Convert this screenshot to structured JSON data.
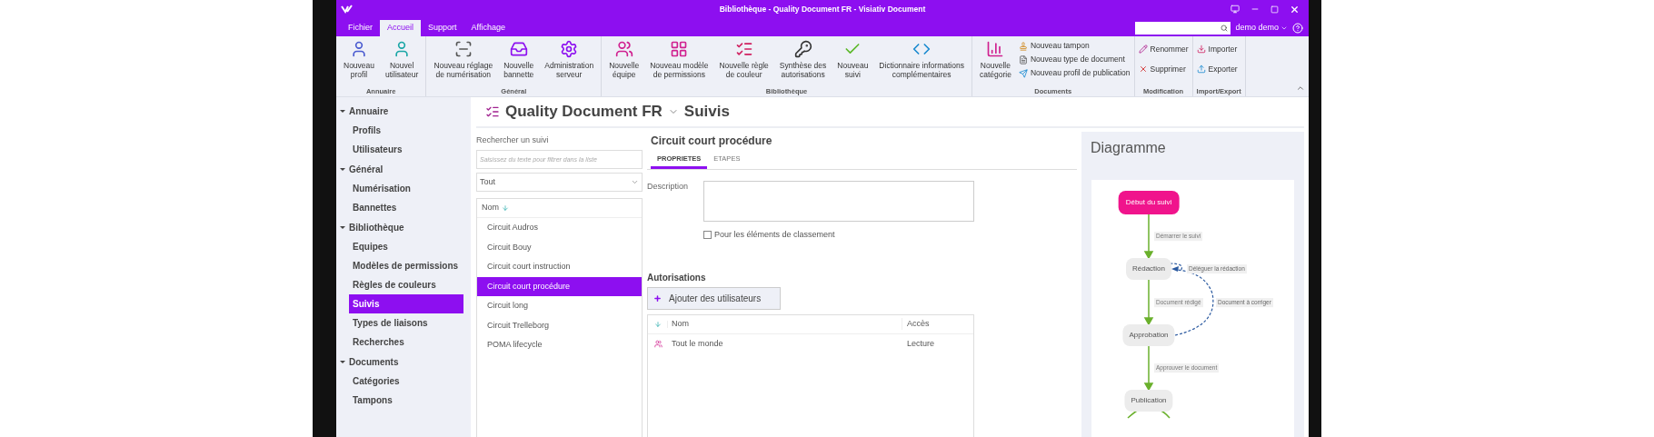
{
  "window": {
    "title": "Bibliothèque - Quality Document FR - Visiativ Document"
  },
  "menu_tabs": [
    {
      "label": "Fichier",
      "selected": false
    },
    {
      "label": "Accueil",
      "selected": true
    },
    {
      "label": "Support",
      "selected": false
    },
    {
      "label": "Affichage",
      "selected": false
    }
  ],
  "user": {
    "name": "demo demo"
  },
  "ribbon": [
    {
      "group": "Annuaire",
      "items": [
        {
          "label": "Nouveau\nprofil"
        },
        {
          "label": "Nouvel\nutilisateur"
        }
      ]
    },
    {
      "group": "Général",
      "items": [
        {
          "label": "Nouveau réglage\nde numérisation"
        },
        {
          "label": "Nouvelle\nbannette"
        },
        {
          "label": "Administration\nserveur"
        }
      ]
    },
    {
      "group": "Bibliothèque",
      "items": [
        {
          "label": "Nouvelle\néquipe"
        },
        {
          "label": "Nouveau modèle\nde permissions"
        },
        {
          "label": "Nouvelle règle\nde couleur"
        },
        {
          "label": "Synthèse des\nautorisations"
        },
        {
          "label": "Nouveau\nsuivi"
        },
        {
          "label": "Dictionnaire informations\ncomplémentaires"
        }
      ]
    },
    {
      "group": "Documents",
      "items": [
        {
          "label": "Nouvelle\ncatégorie"
        }
      ],
      "small": [
        {
          "label": "Nouveau tampon"
        },
        {
          "label": "Nouveau type de document"
        },
        {
          "label": "Nouveau profil de publication"
        }
      ]
    },
    {
      "group": "Modification",
      "small": [
        {
          "label": "Renommer"
        },
        {
          "label": "Supprimer"
        }
      ]
    },
    {
      "group": "Import/Export",
      "small": [
        {
          "label": "Importer"
        },
        {
          "label": "Exporter"
        }
      ]
    }
  ],
  "sidebar": [
    {
      "label": "Annuaire",
      "expanded": true,
      "children": [
        {
          "label": "Profils",
          "selected": false
        },
        {
          "label": "Utilisateurs",
          "selected": false
        }
      ]
    },
    {
      "label": "Général",
      "expanded": true,
      "children": [
        {
          "label": "Numérisation",
          "selected": false
        },
        {
          "label": "Bannettes",
          "selected": false
        }
      ]
    },
    {
      "label": "Bibliothèque",
      "expanded": true,
      "children": [
        {
          "label": "Equipes",
          "selected": false
        },
        {
          "label": "Modèles de permissions",
          "selected": false
        },
        {
          "label": "Règles de couleurs",
          "selected": false
        },
        {
          "label": "Suivis",
          "selected": true
        },
        {
          "label": "Types de liaisons",
          "selected": false
        },
        {
          "label": "Recherches",
          "selected": false
        }
      ]
    },
    {
      "label": "Documents",
      "expanded": true,
      "children": [
        {
          "label": "Catégories",
          "selected": false
        },
        {
          "label": "Tampons",
          "selected": false
        }
      ]
    }
  ],
  "header": {
    "library": "Quality Document FR",
    "section": "Suivis"
  },
  "list": {
    "search_label": "Rechercher un suivi",
    "search_placeholder": "Saisissez du texte pour filtrer dans la liste",
    "filter": "Tout",
    "column": "Nom",
    "items": [
      {
        "label": "Circuit Audros",
        "selected": false
      },
      {
        "label": "Circuit Bouy",
        "selected": false
      },
      {
        "label": "Circuit court instruction",
        "selected": false
      },
      {
        "label": "Circuit court procédure",
        "selected": true
      },
      {
        "label": "Circuit long",
        "selected": false
      },
      {
        "label": "Circuit Trelleborg",
        "selected": false
      },
      {
        "label": "POMA lifecycle",
        "selected": false
      }
    ]
  },
  "detail": {
    "title": "Circuit court procédure",
    "tabs": [
      {
        "label": "PROPRIETES",
        "selected": true
      },
      {
        "label": "ETAPES",
        "selected": false
      }
    ],
    "description_label": "Description",
    "classement": {
      "label": "Pour les éléments de classement",
      "checked": false
    },
    "autorisations_title": "Autorisations",
    "add_button": "Ajouter des utilisateurs",
    "table": {
      "columns": [
        "Nom",
        "Accès"
      ],
      "rows": [
        {
          "name": "Tout le monde",
          "access": "Lecture"
        }
      ]
    }
  },
  "diagram": {
    "title": "Diagramme",
    "nodes": [
      {
        "label": "Début du suivi",
        "kind": "start"
      },
      {
        "label": "Rédaction",
        "kind": "step"
      },
      {
        "label": "Approbation",
        "kind": "step"
      },
      {
        "label": "Publication",
        "kind": "step"
      }
    ],
    "transitions": [
      {
        "label": "Démarrer le suivi",
        "kind": "forward"
      },
      {
        "label": "Déléguer la rédaction",
        "kind": "loop"
      },
      {
        "label": "Document rédigé",
        "kind": "forward"
      },
      {
        "label": "Document à corriger",
        "kind": "back"
      },
      {
        "label": "Approuver le document",
        "kind": "forward"
      }
    ]
  }
}
